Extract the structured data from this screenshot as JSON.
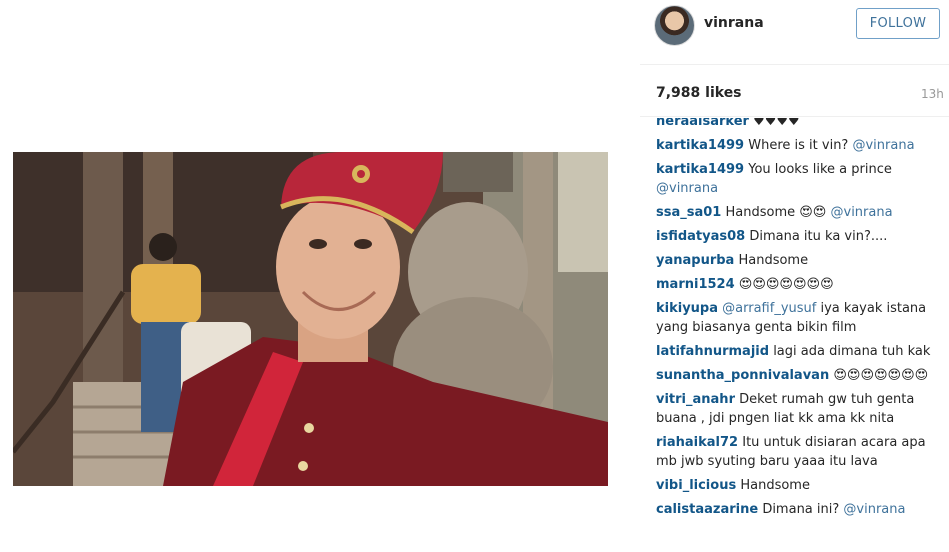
{
  "post": {
    "username": "vinrana",
    "follow_label": "FOLLOW",
    "likes": "7,988 likes",
    "time": "13h"
  },
  "comments": [
    {
      "user": "heraalsarker",
      "text": "♥♥♥♥",
      "mention": ""
    },
    {
      "user": "kartika1499",
      "text": "Where is it vin?",
      "mention": "@vinrana"
    },
    {
      "user": "kartika1499",
      "text": "You looks like a prince",
      "mention": "@vinrana"
    },
    {
      "user": "ssa_sa01",
      "text": "Handsome 😍😍",
      "mention": "@vinrana"
    },
    {
      "user": "isfidatyas08",
      "text": "Dimana itu ka vin?....",
      "mention": ""
    },
    {
      "user": "yanapurba",
      "text": "Handsome",
      "mention": ""
    },
    {
      "user": "marni1524",
      "text": "😍😍😍😍😍😍😍",
      "mention": ""
    },
    {
      "user": "kikiyupa",
      "text": "iya kayak istana yang biasanya genta bikin film",
      "mention": "@arrafif_yusuf"
    },
    {
      "user": "latifahnurmajid",
      "text": "lagi ada dimana tuh kak",
      "mention": ""
    },
    {
      "user": "sunantha_ponnivalavan",
      "text": "😍😍😍😍😍😍😍",
      "mention": ""
    },
    {
      "user": "vitri_anahr",
      "text": "Deket rumah gw tuh genta buana , jdi pngen liat kk ama kk nita",
      "mention": ""
    },
    {
      "user": "riahaikal72",
      "text": "Itu untuk disiaran acara apa mb jwb syuting baru yaaa itu lava",
      "mention": ""
    },
    {
      "user": "vibi_licious",
      "text": "Handsome",
      "mention": ""
    },
    {
      "user": "calistaazarine",
      "text": "Dimana ini?",
      "mention": "@vinrana"
    }
  ],
  "icons": {
    "avatar": "profile-photo",
    "photo": "selfie-photo"
  }
}
